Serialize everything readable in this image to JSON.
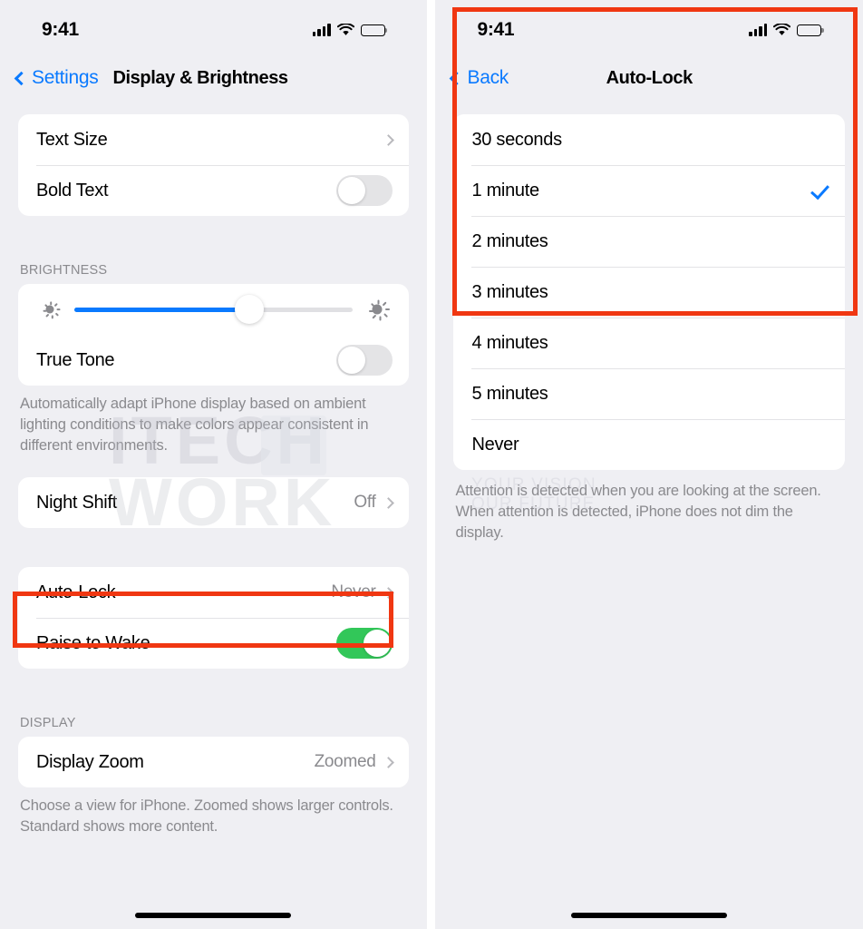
{
  "left_phone": {
    "status_bar": {
      "time": "9:41",
      "signal_icon": "cellular-signal-icon",
      "wifi_icon": "wifi-icon",
      "battery_icon": "battery-full-icon"
    },
    "nav": {
      "back_label": "Settings",
      "back_icon": "chevron-left-icon",
      "title": "Display & Brightness"
    },
    "groups": [
      {
        "rows": [
          {
            "label": "Text Size",
            "value": "",
            "accessory": "chevron"
          },
          {
            "label": "Bold Text",
            "value": "",
            "accessory": "toggle",
            "toggle_on": false
          }
        ]
      }
    ],
    "brightness": {
      "header": "BRIGHTNESS",
      "slider_percent": 63,
      "slider_min_icon": "sun-small-icon",
      "slider_max_icon": "sun-large-icon",
      "true_tone": {
        "label": "True Tone",
        "toggle_on": false
      },
      "footer": "Automatically adapt iPhone display based on ambient lighting conditions to make colors appear consistent in different environments."
    },
    "night_shift": {
      "label": "Night Shift",
      "value": "Off",
      "accessory": "chevron"
    },
    "autolock_group": {
      "rows": [
        {
          "label": "Auto-Lock",
          "value": "Never",
          "accessory": "chevron",
          "highlighted": true
        },
        {
          "label": "Raise to Wake",
          "value": "",
          "accessory": "toggle",
          "toggle_on": true
        }
      ]
    },
    "display_section": {
      "header": "DISPLAY",
      "row": {
        "label": "Display Zoom",
        "value": "Zoomed",
        "accessory": "chevron"
      },
      "footer": "Choose a view for iPhone. Zoomed shows larger controls. Standard shows more content."
    }
  },
  "right_phone": {
    "status_bar": {
      "time": "9:41",
      "signal_icon": "cellular-signal-icon",
      "wifi_icon": "wifi-icon",
      "battery_icon": "battery-full-icon"
    },
    "nav": {
      "back_label": "Back",
      "back_icon": "chevron-left-icon",
      "title": "Auto-Lock"
    },
    "options": [
      {
        "label": "30 seconds",
        "selected": false
      },
      {
        "label": "1 minute",
        "selected": true
      },
      {
        "label": "2 minutes",
        "selected": false
      },
      {
        "label": "3 minutes",
        "selected": false
      },
      {
        "label": "4 minutes",
        "selected": false
      },
      {
        "label": "5 minutes",
        "selected": false
      },
      {
        "label": "Never",
        "selected": false
      }
    ],
    "footer": "Attention is detected when you are looking at the screen. When attention is detected, iPhone does not dim the display."
  },
  "watermark": {
    "line1": "ITECH",
    "line2": "WORK",
    "tagline_1": "YOUR VISION",
    "tagline_2": "OUR FUTURE"
  },
  "colors": {
    "accent_blue": "#0a7aff",
    "toggle_green": "#32c759",
    "highlight_red": "#f03712",
    "background": "#efeff3",
    "card": "#ffffff",
    "secondary_text": "#8a8a8e"
  }
}
